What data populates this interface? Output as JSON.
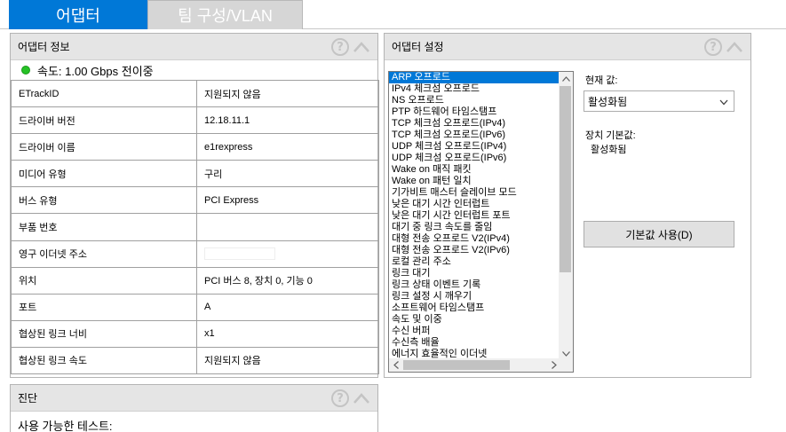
{
  "tabs": [
    {
      "label": "어댑터",
      "active": true
    },
    {
      "label": "팀 구성/VLAN",
      "active": false
    }
  ],
  "adapter_info": {
    "title": "어댑터 정보",
    "status_color": "#27c227",
    "speed": "속도: 1.00 Gbps 전이중",
    "rows": [
      {
        "key": "ETrackID",
        "value": "지원되지 않음"
      },
      {
        "key": "드라이버 버전",
        "value": "12.18.11.1"
      },
      {
        "key": "드라이버 이름",
        "value": "e1rexpress"
      },
      {
        "key": "미디어 유형",
        "value": "구리"
      },
      {
        "key": "버스 유형",
        "value": "PCI Express"
      },
      {
        "key": "부품 번호",
        "value": ""
      },
      {
        "key": "영구 이더넷 주소",
        "value": ""
      },
      {
        "key": "위치",
        "value": "PCI 버스 8, 장치 0, 기능 0"
      },
      {
        "key": "포트",
        "value": "A"
      },
      {
        "key": "협상된 링크 너비",
        "value": "x1"
      },
      {
        "key": "협상된 링크 속도",
        "value": "지원되지 않음"
      }
    ]
  },
  "adapter_settings": {
    "title": "어댑터 설정",
    "items": [
      "ARP 오프로드",
      "IPv4 체크섬 오프로드",
      "NS 오프로드",
      "PTP 하드웨어 타임스탬프",
      "TCP 체크섬 오프로드(IPv4)",
      "TCP 체크섬 오프로드(IPv6)",
      "UDP 체크섬 오프로드(IPv4)",
      "UDP 체크섬 오프로드(IPv6)",
      "Wake on 매직 패킷",
      "Wake on 패턴 일치",
      "기가비트 매스터 슬레이브 모드",
      "낮은 대기 시간 인터럽트",
      "낮은 대기 시간 인터럽트 포트",
      "대기 중 링크 속도를 줄임",
      "대형 전송 오프로드 V2(IPv4)",
      "대형 전송 오프로드 V2(IPv6)",
      "로컬 관리 주소",
      "링크 대기",
      "링크 상태 이벤트 기록",
      "링크 설정 시 깨우기",
      "소프트웨어 타임스탬프",
      "속도 및 이중",
      "수신 버퍼",
      "수신측 배율",
      "에너지 효율적인 이더넷"
    ],
    "selected_index": 0,
    "current_value_label": "현재 값:",
    "current_value": "활성화됨",
    "default_label": "장치 기본값:",
    "default_value": "활성화됨",
    "use_default_button": "기본값 사용(D)"
  },
  "diagnostics": {
    "title": "진단",
    "available_tests_label": "사용 가능한 테스트:"
  },
  "icons": {
    "help": "help-icon",
    "collapse": "chevron-up-icon",
    "status": "status-dot-icon"
  },
  "colors": {
    "accent": "#0078d7",
    "header_bg": "#e5e5e5",
    "inactive_tab": "#d6d6d6"
  }
}
